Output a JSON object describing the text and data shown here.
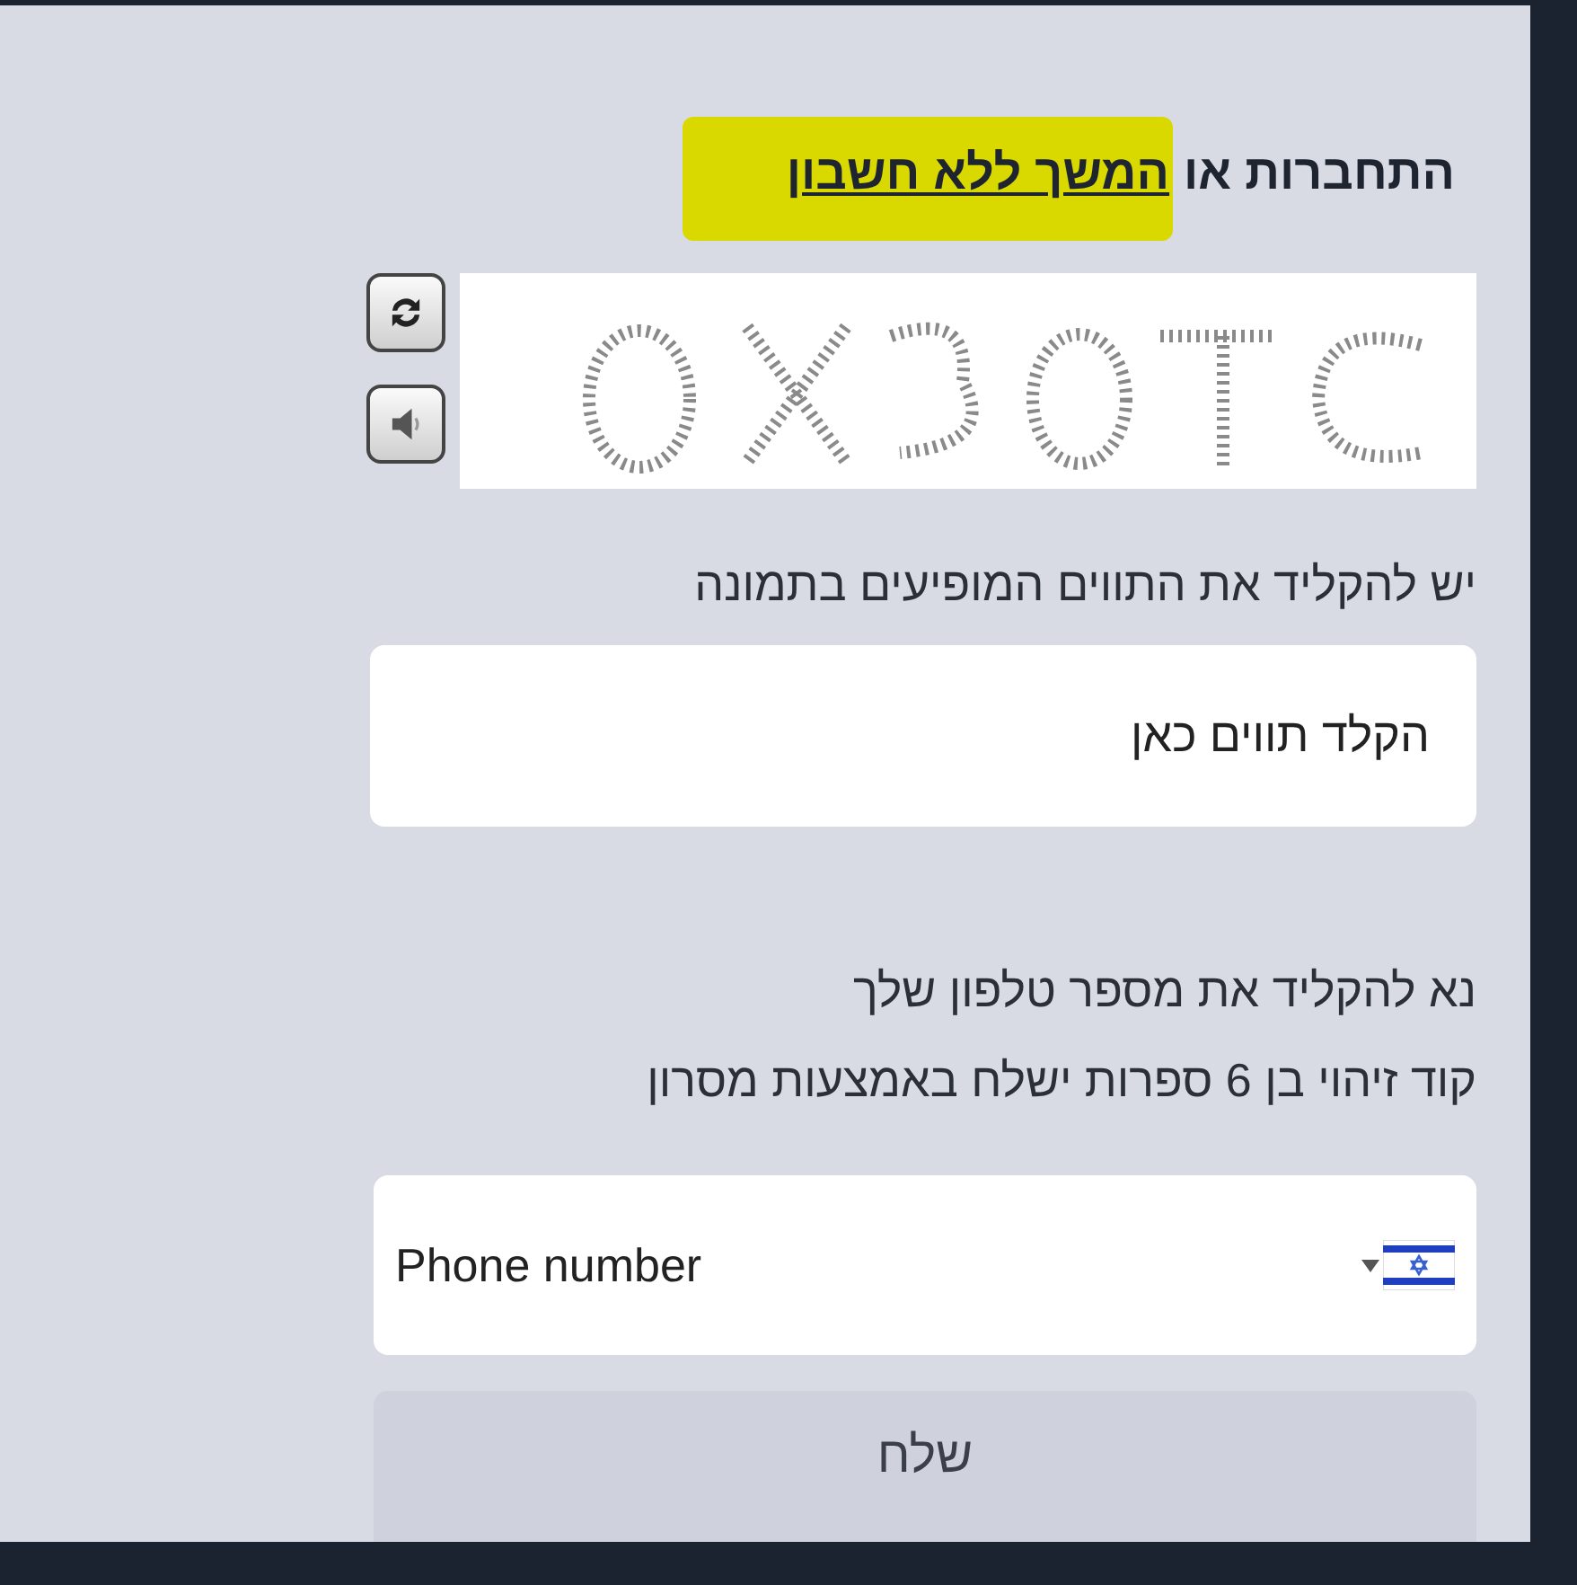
{
  "heading": {
    "text": "התחברות או",
    "link": "המשך ללא חשבון",
    "highlighted": true
  },
  "captcha_label": "יש להקליד את התווים המופיעים בתמונה",
  "captcha_field": {
    "placeholder": "הקלד תווים כאן"
  },
  "phone_instructions": [
    "נא להקליד את מספר טלפון שלך",
    "קוד זיהוי בן 6 ספרות ישלח באמצעות מסרון"
  ],
  "phone_field": {
    "placeholder": "Phone number"
  },
  "submit_button": {
    "label": "שלח"
  }
}
